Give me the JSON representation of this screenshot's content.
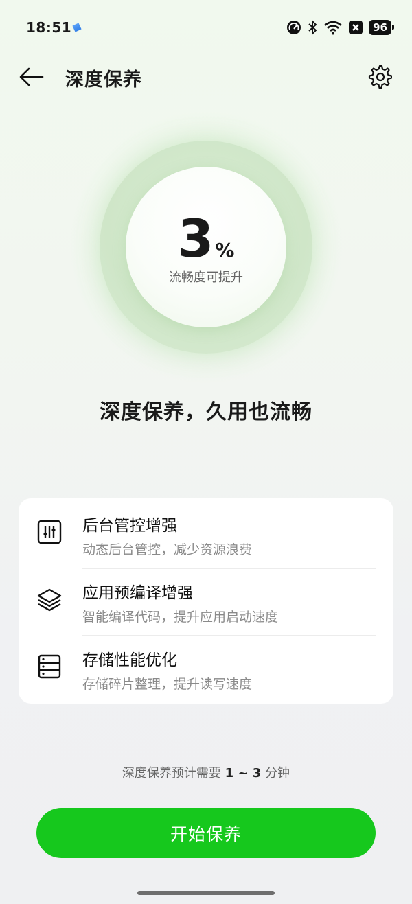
{
  "status_bar": {
    "time": "18:51",
    "battery": "96",
    "icons": [
      "app-notification-icon",
      "speedometer-icon",
      "bluetooth-icon",
      "wifi-icon",
      "x-app-icon",
      "battery-icon"
    ]
  },
  "header": {
    "title": "深度保养",
    "back_icon": "arrow-left-icon",
    "settings_icon": "gear-icon"
  },
  "gauge": {
    "value": "3",
    "unit": "%",
    "caption": "流畅度可提升"
  },
  "slogan": "深度保养，久用也流畅",
  "features": [
    {
      "icon": "sliders-icon",
      "title": "后台管控增强",
      "desc": "动态后台管控，减少资源浪费"
    },
    {
      "icon": "layers-icon",
      "title": "应用预编译增强",
      "desc": "智能编译代码，提升应用启动速度"
    },
    {
      "icon": "storage-icon",
      "title": "存储性能优化",
      "desc": "存储碎片整理，提升读写速度"
    }
  ],
  "estimate": {
    "prefix": "深度保养预计需要 ",
    "range": "1 ~ 3",
    "suffix": " 分钟"
  },
  "start_button": "开始保养",
  "colors": {
    "accent": "#16c81d",
    "ring": "#cfe6c8"
  }
}
